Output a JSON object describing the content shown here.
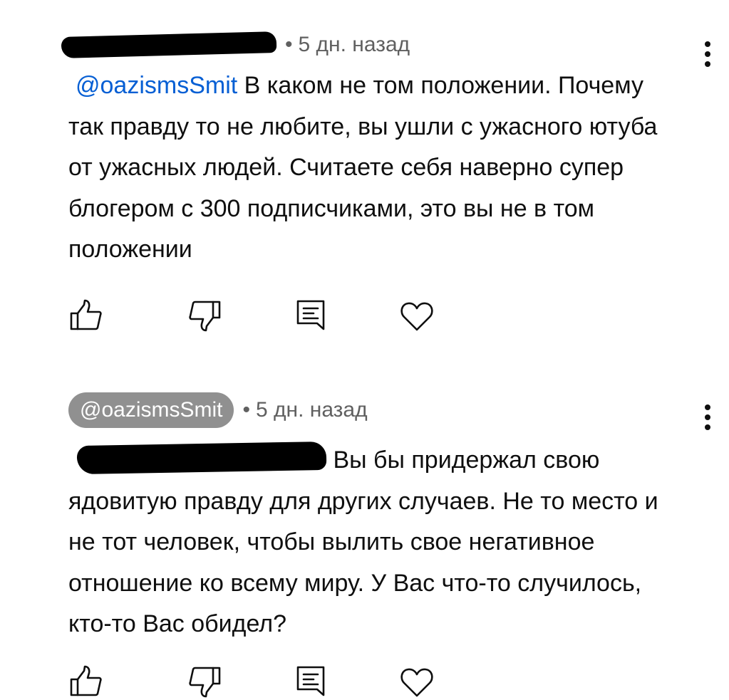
{
  "comments": [
    {
      "author": "",
      "author_redacted": true,
      "time": "5 дн. назад",
      "mention": "@oazismsSmit",
      "mention_redacted": false,
      "text": "В каком не том положении. Почему так правду то не любите, вы ушли с ужасного ютуба от ужасных людей. Считаете себя наверно супер блогером с 300 подписчиками, это вы не в том положении"
    },
    {
      "author": "@oazismsSmit",
      "author_redacted": false,
      "time": "5 дн. назад",
      "mention": "",
      "mention_redacted": true,
      "text": "Вы бы придержал свою ядовитую правду для других случаев. Не то место и не тот человек, чтобы вылить свое негативное отношение ко всему миру. У Вас что-то случилось, кто-то Вас обидел?"
    }
  ],
  "meta_separator": "•",
  "icons": {
    "like": "thumbs-up-icon",
    "dislike": "thumbs-down-icon",
    "reply": "reply-icon",
    "heart": "heart-icon",
    "menu": "more-vertical-icon"
  },
  "colors": {
    "text": "#0f0f0f",
    "secondary": "#606060",
    "link": "#065fd4",
    "chip": "#909090"
  }
}
